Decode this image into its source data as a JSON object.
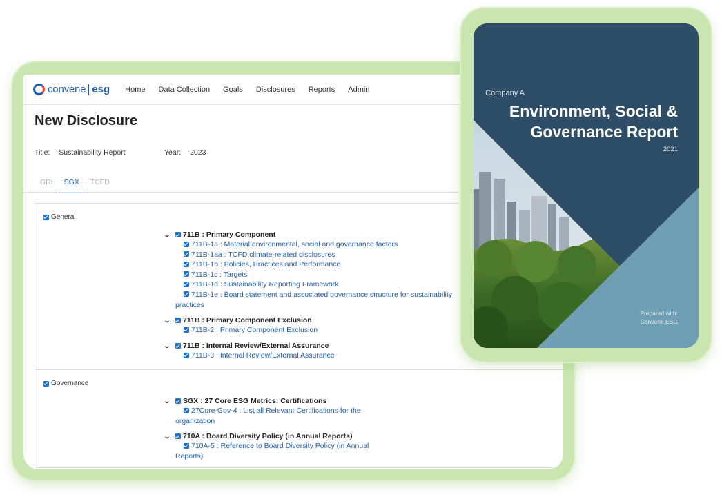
{
  "app": {
    "logo": {
      "brand": "convene",
      "product": "esg"
    },
    "nav": [
      "Home",
      "Data Collection",
      "Goals",
      "Disclosures",
      "Reports",
      "Admin"
    ],
    "page_title": "New Disclosure",
    "meta": {
      "title_label": "Title:",
      "title_value": "Sustainability Report",
      "year_label": "Year:",
      "year_value": "2023"
    },
    "tabs": [
      "GRI",
      "SGX",
      "TCFD"
    ],
    "active_tab": "SGX",
    "sections": [
      {
        "label": "General",
        "groups": [
          {
            "title": "711B : Primary Component",
            "items": [
              "711B-1a : Material environmental, social and governance factors",
              "711B-1aa : TCFD climate-related disclosures",
              "711B-1b : Policies, Practices and Performance",
              "711B-1c : Targets",
              "711B-1d : Sustainability Reporting Framework",
              "711B-1e : Board statement and associated governance structure for sustainability practices"
            ]
          },
          {
            "title": "711B : Primary Component Exclusion",
            "items": [
              "711B-2 : Primary Component Exclusion"
            ]
          },
          {
            "title": "711B : Internal Review/External Assurance",
            "items": [
              "711B-3 : Internal Review/External Assurance"
            ]
          }
        ]
      },
      {
        "label": "Governance",
        "groups": [
          {
            "title": "SGX : 27 Core ESG Metrics: Certifications",
            "items": [
              "27Core-Gov-4 : List all Relevant Certifications for the organization"
            ]
          },
          {
            "title": "710A : Board Diversity Policy (in Annual Reports)",
            "items": [
              "710A-5 : Reference to Board Diversity Policy (in Annual Reports)"
            ]
          }
        ]
      }
    ]
  },
  "report_card": {
    "company": "Company A",
    "title_line1": "Environment, Social &",
    "title_line2": "Governance Report",
    "year": "2021",
    "prepared_line1": "Prepared with:",
    "prepared_line2": "Convene ESG"
  },
  "colors": {
    "brand_blue": "#1f5fa8",
    "frame_green": "#c9e6b0",
    "card_navy": "#2f4d66",
    "card_teal": "#6f9fb5",
    "checkbox_blue": "#1a73c8"
  },
  "icons": [
    "convene-logo-icon",
    "chevron-down-icon",
    "checkbox-checked-icon"
  ]
}
